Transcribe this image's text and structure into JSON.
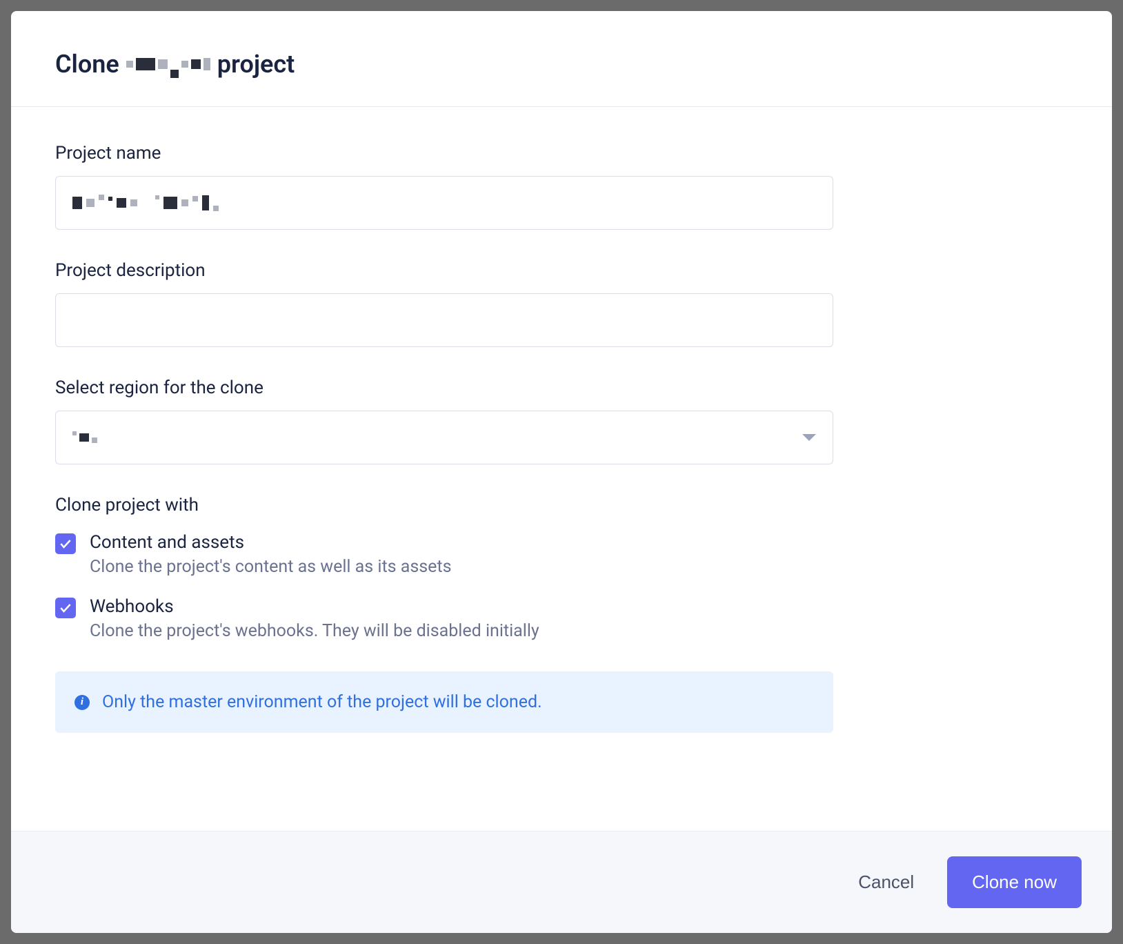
{
  "modal": {
    "title_prefix": "Clone",
    "title_suffix": "project"
  },
  "form": {
    "project_name": {
      "label": "Project name",
      "value_redacted": true
    },
    "project_description": {
      "label": "Project description",
      "value": ""
    },
    "region": {
      "label": "Select region for the clone",
      "selected_redacted": true
    },
    "clone_with": {
      "heading": "Clone project with",
      "options": [
        {
          "label": "Content and assets",
          "description": "Clone the project's content as well as its assets",
          "checked": true
        },
        {
          "label": "Webhooks",
          "description": "Clone the project's webhooks. They will be disabled initially",
          "checked": true
        }
      ]
    },
    "info": "Only the master environment of the project will be cloned."
  },
  "footer": {
    "cancel": "Cancel",
    "submit": "Clone now"
  },
  "colors": {
    "primary": "#6366f1",
    "info_bg": "#e9f3ff",
    "info_text": "#2f6fe0"
  }
}
